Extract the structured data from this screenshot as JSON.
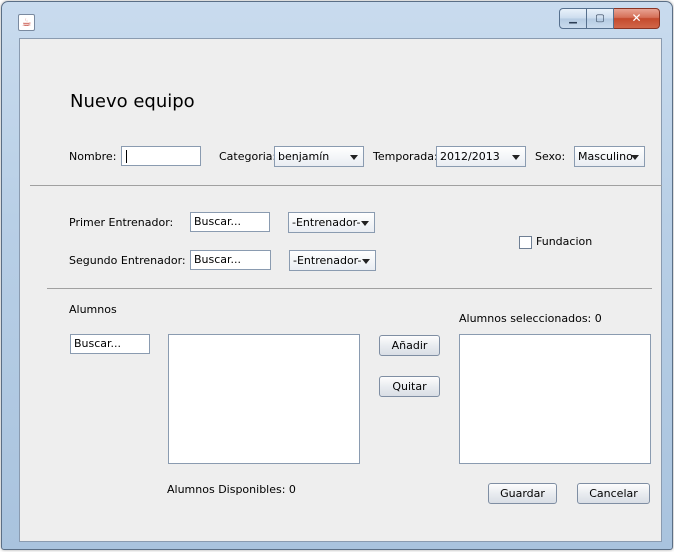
{
  "window": {
    "icon": "java-cup-icon",
    "controls": {
      "minimize": "▁",
      "maximize": "▢",
      "close": "✕"
    }
  },
  "form": {
    "title": "Nuevo equipo",
    "nombre": {
      "label": "Nombre:",
      "value": ""
    },
    "categoria": {
      "label": "Categoria:",
      "selected": "benjamín"
    },
    "temporada": {
      "label": "Temporada:",
      "selected": "2012/2013"
    },
    "sexo": {
      "label": "Sexo:",
      "selected": "Masculino"
    },
    "primer_entrenador": {
      "label": "Primer Entrenador:",
      "search_value": "Buscar...",
      "selected": "-Entrenador-"
    },
    "segundo_entrenador": {
      "label": "Segundo Entrenador:",
      "search_value": "Buscar...",
      "selected": "-Entrenador-"
    },
    "fundacion": {
      "label": "Fundacion",
      "checked": false
    },
    "alumnos": {
      "section_label": "Alumnos",
      "search_value": "Buscar...",
      "disponibles_label": "Alumnos Disponibles: 0",
      "seleccionados_label": "Alumnos seleccionados:  0",
      "add_button": "Añadir",
      "remove_button": "Quitar"
    },
    "actions": {
      "save": "Guardar",
      "cancel": "Cancelar"
    }
  }
}
